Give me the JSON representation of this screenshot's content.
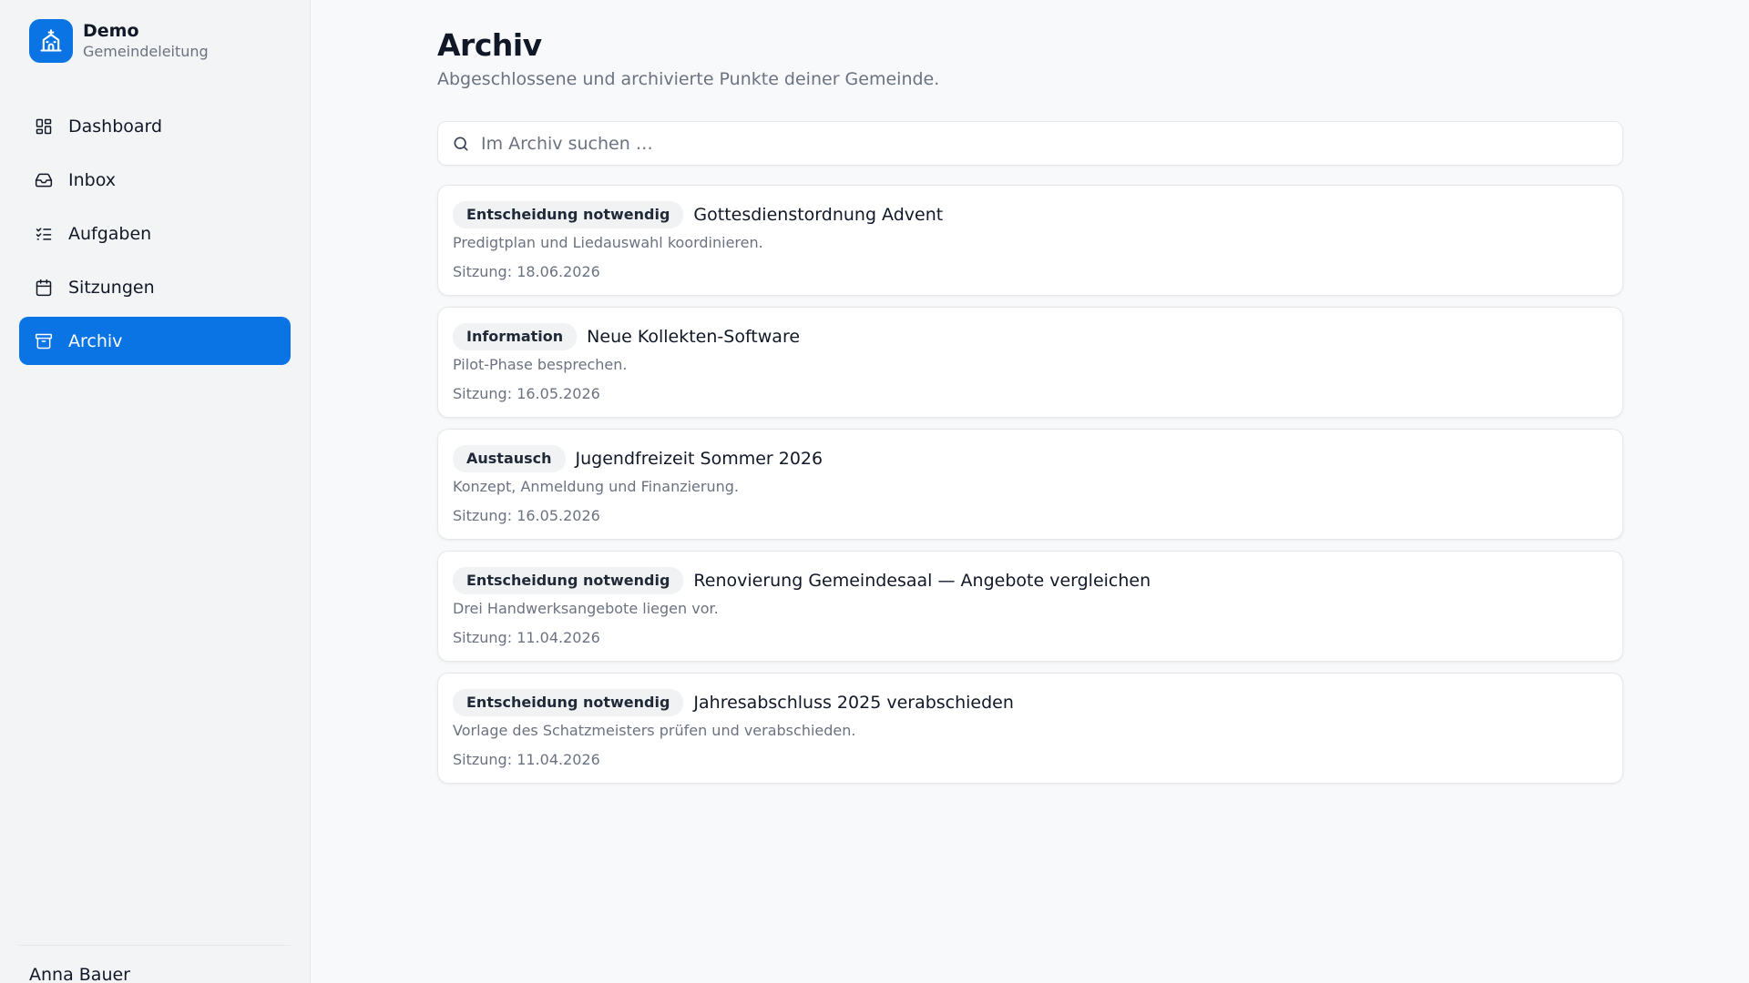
{
  "brand": {
    "name": "Demo",
    "subtitle": "Gemeindeleitung",
    "logo_icon": "church-icon",
    "color": "#0b74e5"
  },
  "nav": {
    "items": [
      {
        "label": "Dashboard",
        "icon": "dashboard-icon",
        "active": false
      },
      {
        "label": "Inbox",
        "icon": "inbox-icon",
        "active": false
      },
      {
        "label": "Aufgaben",
        "icon": "checklist-icon",
        "active": false
      },
      {
        "label": "Sitzungen",
        "icon": "calendar-icon",
        "active": false
      },
      {
        "label": "Archiv",
        "icon": "archive-icon",
        "active": true
      }
    ]
  },
  "user": {
    "name": "Anna Bauer"
  },
  "page": {
    "title": "Archiv",
    "subtitle": "Abgeschlossene und archivierte Punkte deiner Gemeinde."
  },
  "search": {
    "placeholder": "Im Archiv suchen …",
    "value": ""
  },
  "items": [
    {
      "badge": "Entscheidung notwendig",
      "title": "Gottesdienstordnung Advent",
      "description": "Predigtplan und Liedauswahl koordinieren.",
      "meta": "Sitzung: 18.06.2026"
    },
    {
      "badge": "Information",
      "title": "Neue Kollekten-Software",
      "description": "Pilot-Phase besprechen.",
      "meta": "Sitzung: 16.05.2026"
    },
    {
      "badge": "Austausch",
      "title": "Jugendfreizeit Sommer 2026",
      "description": "Konzept, Anmeldung und Finanzierung.",
      "meta": "Sitzung: 16.05.2026"
    },
    {
      "badge": "Entscheidung notwendig",
      "title": "Renovierung Gemeindesaal — Angebote vergleichen",
      "description": "Drei Handwerksangebote liegen vor.",
      "meta": "Sitzung: 11.04.2026"
    },
    {
      "badge": "Entscheidung notwendig",
      "title": "Jahresabschluss 2025 verabschieden",
      "description": "Vorlage des Schatzmeisters prüfen und verabschieden.",
      "meta": "Sitzung: 11.04.2026"
    }
  ]
}
